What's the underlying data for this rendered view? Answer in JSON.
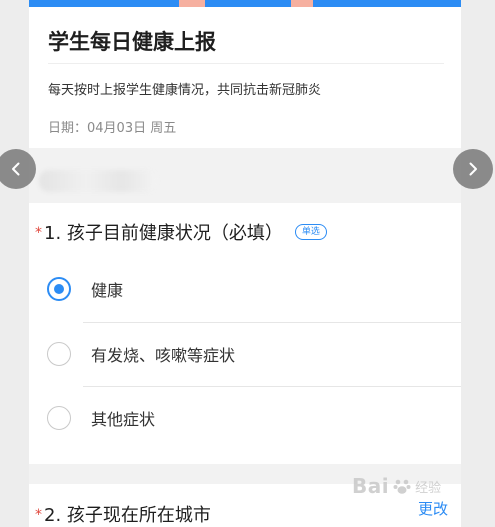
{
  "survey": {
    "title": "学生每日健康上报",
    "description": "每天按时上报学生健康情况，共同抗击新冠肺炎",
    "date": "日期：04月03日 周五"
  },
  "questions": [
    {
      "required_mark": "*",
      "label": "1. 孩子目前健康状况（必填）",
      "badge": "单选",
      "options": [
        {
          "label": "健康",
          "selected": true
        },
        {
          "label": "有发烧、咳嗽等症状",
          "selected": false
        },
        {
          "label": "其他症状",
          "selected": false
        }
      ]
    },
    {
      "required_mark": "*",
      "label": "2. 孩子现在所在城市",
      "action": "更改"
    }
  ],
  "watermark": {
    "text": "Bai",
    "sub": "经验"
  },
  "colors": {
    "accent": "#2c8cf4",
    "required": "#e0463b"
  }
}
